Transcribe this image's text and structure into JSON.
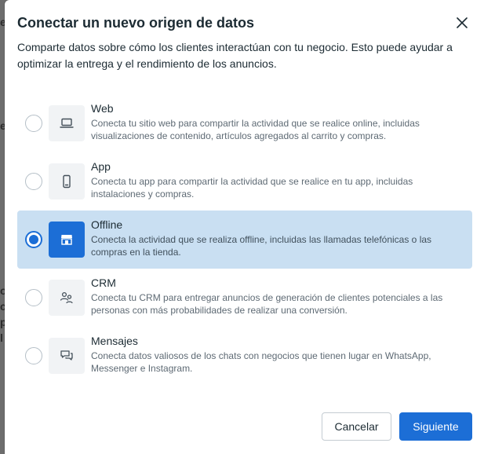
{
  "background": {
    "fragments": [
      "e",
      "e",
      "o",
      "c",
      "p",
      "l"
    ]
  },
  "dialog": {
    "title": "Conectar un nuevo origen de datos",
    "description": "Comparte datos sobre cómo los clientes interactúan con tu negocio. Esto puede ayudar a optimizar la entrega y el rendimiento de los anuncios."
  },
  "options": [
    {
      "id": "web",
      "title": "Web",
      "description": "Conecta tu sitio web para compartir la actividad que se realice online, incluidas visualizaciones de contenido, artículos agregados al carrito y compras.",
      "icon": "laptop-icon",
      "selected": false
    },
    {
      "id": "app",
      "title": "App",
      "description": "Conecta tu app para compartir la actividad que se realice en tu app, incluidas instalaciones y compras.",
      "icon": "phone-icon",
      "selected": false
    },
    {
      "id": "offline",
      "title": "Offline",
      "description": "Conecta la actividad que se realiza offline, incluidas las llamadas telefónicas o las compras en la tienda.",
      "icon": "store-icon",
      "selected": true
    },
    {
      "id": "crm",
      "title": "CRM",
      "description": "Conecta tu CRM para entregar anuncios de generación de clientes potenciales a las personas con más probabilidades de realizar una conversión.",
      "icon": "people-icon",
      "selected": false
    },
    {
      "id": "messages",
      "title": "Mensajes",
      "description": "Conecta datos valiosos de los chats con negocios que tienen lugar en WhatsApp, Messenger e Instagram.",
      "icon": "chat-icon",
      "selected": false
    }
  ],
  "footer": {
    "cancel_label": "Cancelar",
    "next_label": "Siguiente"
  },
  "colors": {
    "accent": "#1c6ed6",
    "selected_bg": "#c9dff2"
  }
}
